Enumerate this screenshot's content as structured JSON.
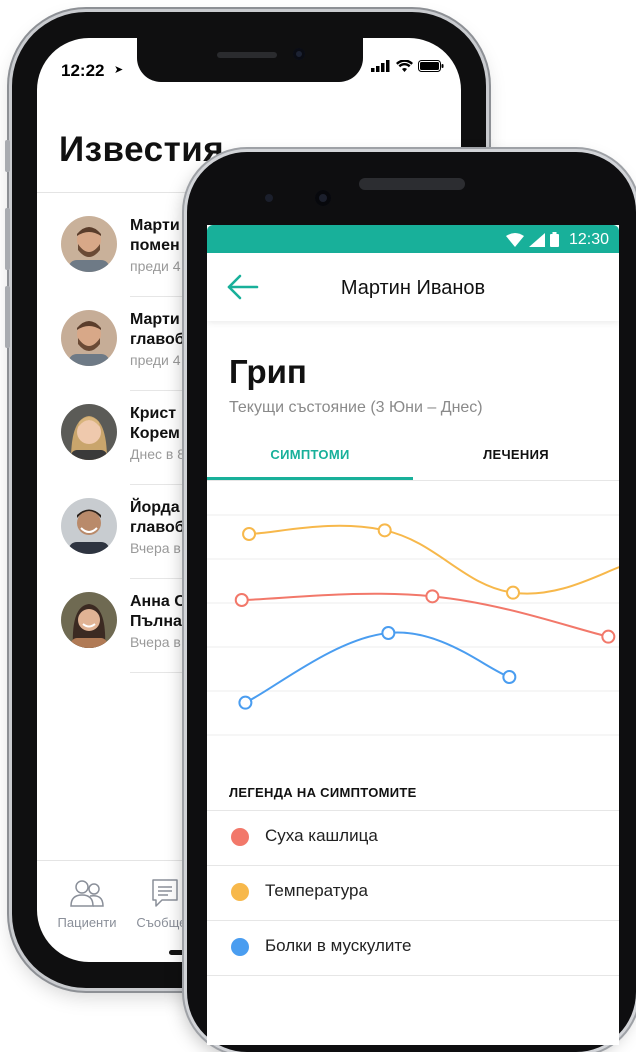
{
  "ios": {
    "status_time": "12:22",
    "title": "Известия",
    "notifications": [
      {
        "line1": "Марти",
        "line2": "помен",
        "time": "преди 4"
      },
      {
        "line1": "Марти",
        "line2": "главоб",
        "time": "преди 4"
      },
      {
        "line1": "Крист",
        "line2": "Корем",
        "time": "Днес в 8"
      },
      {
        "line1": "Йорда",
        "line2": "главоб",
        "time": "Вчера в"
      },
      {
        "line1": "Анна С",
        "line2": "Пълна",
        "time": "Вчера в"
      }
    ],
    "tabbar": {
      "patients_label": "Пациенти",
      "messages_label": "Съобщен"
    }
  },
  "android": {
    "status_time": "12:30",
    "accent_color": "#18b09a",
    "appbar_title": "Мартин Иванов",
    "title": "Грип",
    "subtitle": "Текущи състояние (3 Юни – Днес)",
    "tabs": [
      {
        "label": "СИМПТОМИ",
        "active": true
      },
      {
        "label": "ЛЕЧЕНИЯ",
        "active": false
      }
    ],
    "legend_title": "ЛЕГЕНДА НА СИМПТОМИТЕ",
    "legend": [
      {
        "label": "Суха кашлица",
        "color": "#f2786a"
      },
      {
        "label": "Температура",
        "color": "#f7b84b"
      },
      {
        "label": "Болки в мускулите",
        "color": "#4a9df0"
      }
    ]
  },
  "chart_data": {
    "type": "line",
    "title": "",
    "xlabel": "",
    "ylabel": "",
    "xlim": [
      0,
      10
    ],
    "ylim": [
      0,
      6
    ],
    "grid": true,
    "legend": "below",
    "series": [
      {
        "name": "Температура",
        "color": "#f7b84b",
        "points": [
          [
            0.4,
            5.1
          ],
          [
            4.1,
            5.2
          ],
          [
            7.6,
            3.5
          ],
          [
            10.8,
            4.3
          ]
        ]
      },
      {
        "name": "Суха кашлица",
        "color": "#f2786a",
        "points": [
          [
            0.2,
            3.3
          ],
          [
            5.4,
            3.4
          ],
          [
            10.2,
            2.3
          ]
        ]
      },
      {
        "name": "Болки в мускулите",
        "color": "#4a9df0",
        "points": [
          [
            0.3,
            0.5
          ],
          [
            4.2,
            2.4
          ],
          [
            7.5,
            1.2
          ]
        ]
      }
    ]
  }
}
